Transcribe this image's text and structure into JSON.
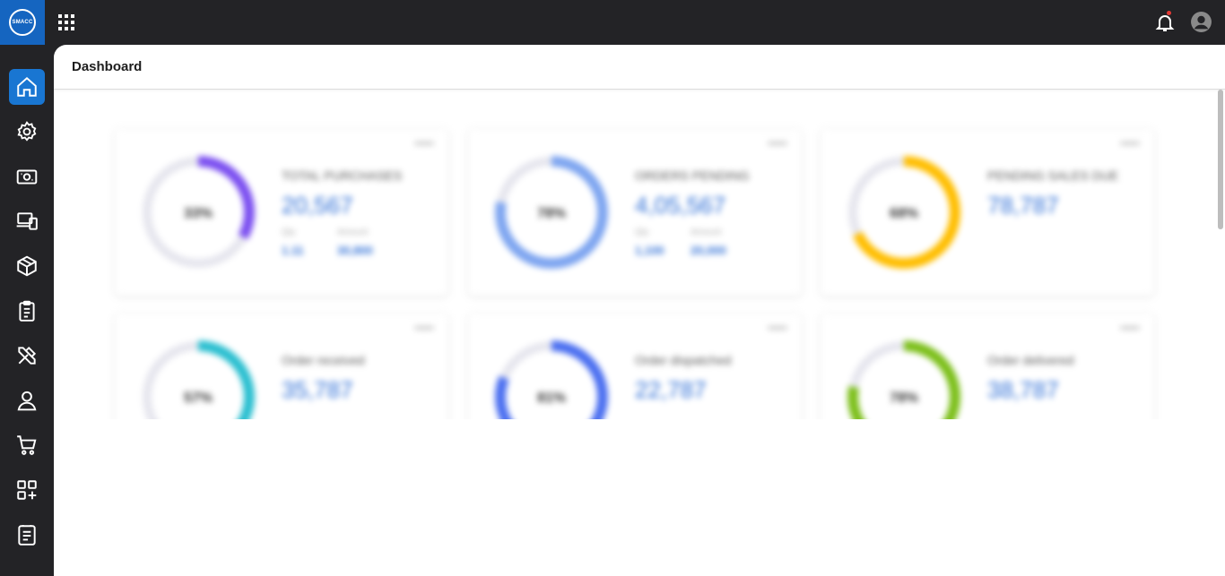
{
  "app": {
    "logo_text": "SMACC",
    "notification_dot_color": "#e53935"
  },
  "topbar": {
    "apps_icon": "grid-apps-icon",
    "bell_icon": "bell-icon",
    "user_icon": "user-account-icon"
  },
  "sidebar": {
    "items": [
      {
        "icon": "home-icon",
        "active": true
      },
      {
        "icon": "settings-icon"
      },
      {
        "icon": "cash-icon"
      },
      {
        "icon": "devices-icon"
      },
      {
        "icon": "package-icon"
      },
      {
        "icon": "clipboard-icon"
      },
      {
        "icon": "tools-icon"
      },
      {
        "icon": "person-icon"
      },
      {
        "icon": "cart-icon"
      },
      {
        "icon": "add-widget-icon"
      },
      {
        "icon": "report-icon"
      }
    ]
  },
  "page": {
    "title": "Dashboard"
  },
  "cards": [
    {
      "percent": "33%",
      "fraction": 0.33,
      "color": "#7b4ff0",
      "title": "TOTAL PURCHASES",
      "value": "20,567",
      "sub1_label": "Qty",
      "sub1_value": "1.11",
      "sub2_label": "Amount",
      "sub2_value": "30,800"
    },
    {
      "percent": "78%",
      "fraction": 0.78,
      "color": "#7ea5f0",
      "title": "ORDERS PENDING",
      "value": "4,05,567",
      "sub1_label": "Qty",
      "sub1_value": "1,100",
      "sub2_label": "Amount",
      "sub2_value": "20,000"
    },
    {
      "percent": "68%",
      "fraction": 0.68,
      "color": "#ffbe00",
      "title": "PENDING SALES DUE",
      "value": "78,787",
      "sub1_label": "",
      "sub1_value": "",
      "sub2_label": "",
      "sub2_value": ""
    },
    {
      "percent": "57%",
      "fraction": 0.57,
      "color": "#2bbfd0",
      "title": "Order received",
      "value": "35,787",
      "sub1_label": "",
      "sub1_value": "",
      "sub2_label": "",
      "sub2_value": ""
    },
    {
      "percent": "81%",
      "fraction": 0.81,
      "color": "#4b6ff0",
      "title": "Order dispatched",
      "value": "22,787",
      "sub1_label": "",
      "sub1_value": "",
      "sub2_label": "",
      "sub2_value": ""
    },
    {
      "percent": "78%",
      "fraction": 0.78,
      "color": "#7cbf1a",
      "title": "Order delivered",
      "value": "38,787",
      "sub1_label": "",
      "sub1_value": "",
      "sub2_label": "",
      "sub2_value": ""
    }
  ]
}
